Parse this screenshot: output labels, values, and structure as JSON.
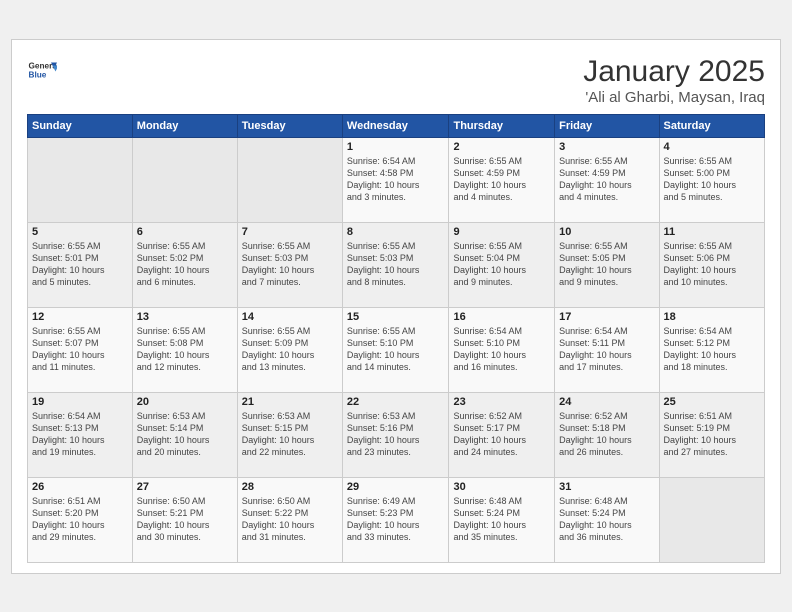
{
  "header": {
    "logo_line1": "General",
    "logo_line2": "Blue",
    "month": "January 2025",
    "location": "'Ali al Gharbi, Maysan, Iraq"
  },
  "weekdays": [
    "Sunday",
    "Monday",
    "Tuesday",
    "Wednesday",
    "Thursday",
    "Friday",
    "Saturday"
  ],
  "weeks": [
    [
      {
        "day": "",
        "info": ""
      },
      {
        "day": "",
        "info": ""
      },
      {
        "day": "",
        "info": ""
      },
      {
        "day": "1",
        "info": "Sunrise: 6:54 AM\nSunset: 4:58 PM\nDaylight: 10 hours\nand 3 minutes."
      },
      {
        "day": "2",
        "info": "Sunrise: 6:55 AM\nSunset: 4:59 PM\nDaylight: 10 hours\nand 4 minutes."
      },
      {
        "day": "3",
        "info": "Sunrise: 6:55 AM\nSunset: 4:59 PM\nDaylight: 10 hours\nand 4 minutes."
      },
      {
        "day": "4",
        "info": "Sunrise: 6:55 AM\nSunset: 5:00 PM\nDaylight: 10 hours\nand 5 minutes."
      }
    ],
    [
      {
        "day": "5",
        "info": "Sunrise: 6:55 AM\nSunset: 5:01 PM\nDaylight: 10 hours\nand 5 minutes."
      },
      {
        "day": "6",
        "info": "Sunrise: 6:55 AM\nSunset: 5:02 PM\nDaylight: 10 hours\nand 6 minutes."
      },
      {
        "day": "7",
        "info": "Sunrise: 6:55 AM\nSunset: 5:03 PM\nDaylight: 10 hours\nand 7 minutes."
      },
      {
        "day": "8",
        "info": "Sunrise: 6:55 AM\nSunset: 5:03 PM\nDaylight: 10 hours\nand 8 minutes."
      },
      {
        "day": "9",
        "info": "Sunrise: 6:55 AM\nSunset: 5:04 PM\nDaylight: 10 hours\nand 9 minutes."
      },
      {
        "day": "10",
        "info": "Sunrise: 6:55 AM\nSunset: 5:05 PM\nDaylight: 10 hours\nand 9 minutes."
      },
      {
        "day": "11",
        "info": "Sunrise: 6:55 AM\nSunset: 5:06 PM\nDaylight: 10 hours\nand 10 minutes."
      }
    ],
    [
      {
        "day": "12",
        "info": "Sunrise: 6:55 AM\nSunset: 5:07 PM\nDaylight: 10 hours\nand 11 minutes."
      },
      {
        "day": "13",
        "info": "Sunrise: 6:55 AM\nSunset: 5:08 PM\nDaylight: 10 hours\nand 12 minutes."
      },
      {
        "day": "14",
        "info": "Sunrise: 6:55 AM\nSunset: 5:09 PM\nDaylight: 10 hours\nand 13 minutes."
      },
      {
        "day": "15",
        "info": "Sunrise: 6:55 AM\nSunset: 5:10 PM\nDaylight: 10 hours\nand 14 minutes."
      },
      {
        "day": "16",
        "info": "Sunrise: 6:54 AM\nSunset: 5:10 PM\nDaylight: 10 hours\nand 16 minutes."
      },
      {
        "day": "17",
        "info": "Sunrise: 6:54 AM\nSunset: 5:11 PM\nDaylight: 10 hours\nand 17 minutes."
      },
      {
        "day": "18",
        "info": "Sunrise: 6:54 AM\nSunset: 5:12 PM\nDaylight: 10 hours\nand 18 minutes."
      }
    ],
    [
      {
        "day": "19",
        "info": "Sunrise: 6:54 AM\nSunset: 5:13 PM\nDaylight: 10 hours\nand 19 minutes."
      },
      {
        "day": "20",
        "info": "Sunrise: 6:53 AM\nSunset: 5:14 PM\nDaylight: 10 hours\nand 20 minutes."
      },
      {
        "day": "21",
        "info": "Sunrise: 6:53 AM\nSunset: 5:15 PM\nDaylight: 10 hours\nand 22 minutes."
      },
      {
        "day": "22",
        "info": "Sunrise: 6:53 AM\nSunset: 5:16 PM\nDaylight: 10 hours\nand 23 minutes."
      },
      {
        "day": "23",
        "info": "Sunrise: 6:52 AM\nSunset: 5:17 PM\nDaylight: 10 hours\nand 24 minutes."
      },
      {
        "day": "24",
        "info": "Sunrise: 6:52 AM\nSunset: 5:18 PM\nDaylight: 10 hours\nand 26 minutes."
      },
      {
        "day": "25",
        "info": "Sunrise: 6:51 AM\nSunset: 5:19 PM\nDaylight: 10 hours\nand 27 minutes."
      }
    ],
    [
      {
        "day": "26",
        "info": "Sunrise: 6:51 AM\nSunset: 5:20 PM\nDaylight: 10 hours\nand 29 minutes."
      },
      {
        "day": "27",
        "info": "Sunrise: 6:50 AM\nSunset: 5:21 PM\nDaylight: 10 hours\nand 30 minutes."
      },
      {
        "day": "28",
        "info": "Sunrise: 6:50 AM\nSunset: 5:22 PM\nDaylight: 10 hours\nand 31 minutes."
      },
      {
        "day": "29",
        "info": "Sunrise: 6:49 AM\nSunset: 5:23 PM\nDaylight: 10 hours\nand 33 minutes."
      },
      {
        "day": "30",
        "info": "Sunrise: 6:48 AM\nSunset: 5:24 PM\nDaylight: 10 hours\nand 35 minutes."
      },
      {
        "day": "31",
        "info": "Sunrise: 6:48 AM\nSunset: 5:24 PM\nDaylight: 10 hours\nand 36 minutes."
      },
      {
        "day": "",
        "info": ""
      }
    ]
  ]
}
